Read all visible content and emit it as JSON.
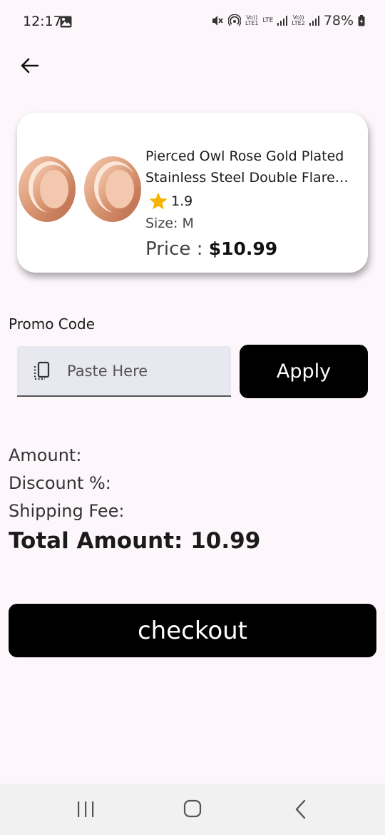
{
  "status_bar": {
    "time": "12:17",
    "lte1_top": "Vo))",
    "lte1_bottom": "LTE1",
    "lte_label": "LTE",
    "lte2_top": "Vo))",
    "lte2_bottom": "LTE2",
    "battery": "78%"
  },
  "product": {
    "title": "Pierced Owl Rose Gold Plated Stainless Steel Double Flared Tunnel Plugs",
    "rating": "1.9",
    "size": "Size: M",
    "price_label": "Price : ",
    "price_value": "$10.99"
  },
  "promo": {
    "label": "Promo Code",
    "placeholder": "Paste Here",
    "value": "",
    "apply_label": "Apply"
  },
  "summary": {
    "amount": "Amount:",
    "discount": "Discount %:",
    "shipping": "Shipping Fee:",
    "total": "Total Amount: 10.99"
  },
  "checkout_label": "checkout",
  "colors": {
    "background": "#fdf7fc",
    "button": "#000000",
    "star": "#f5b400",
    "field": "#e7e8f0"
  },
  "icons": [
    "back-arrow-icon",
    "star-icon",
    "paste-icon",
    "gallery-icon",
    "mute-icon",
    "hotspot-icon",
    "signal-icon",
    "battery-icon",
    "recent-apps-icon",
    "home-icon",
    "nav-back-icon"
  ]
}
